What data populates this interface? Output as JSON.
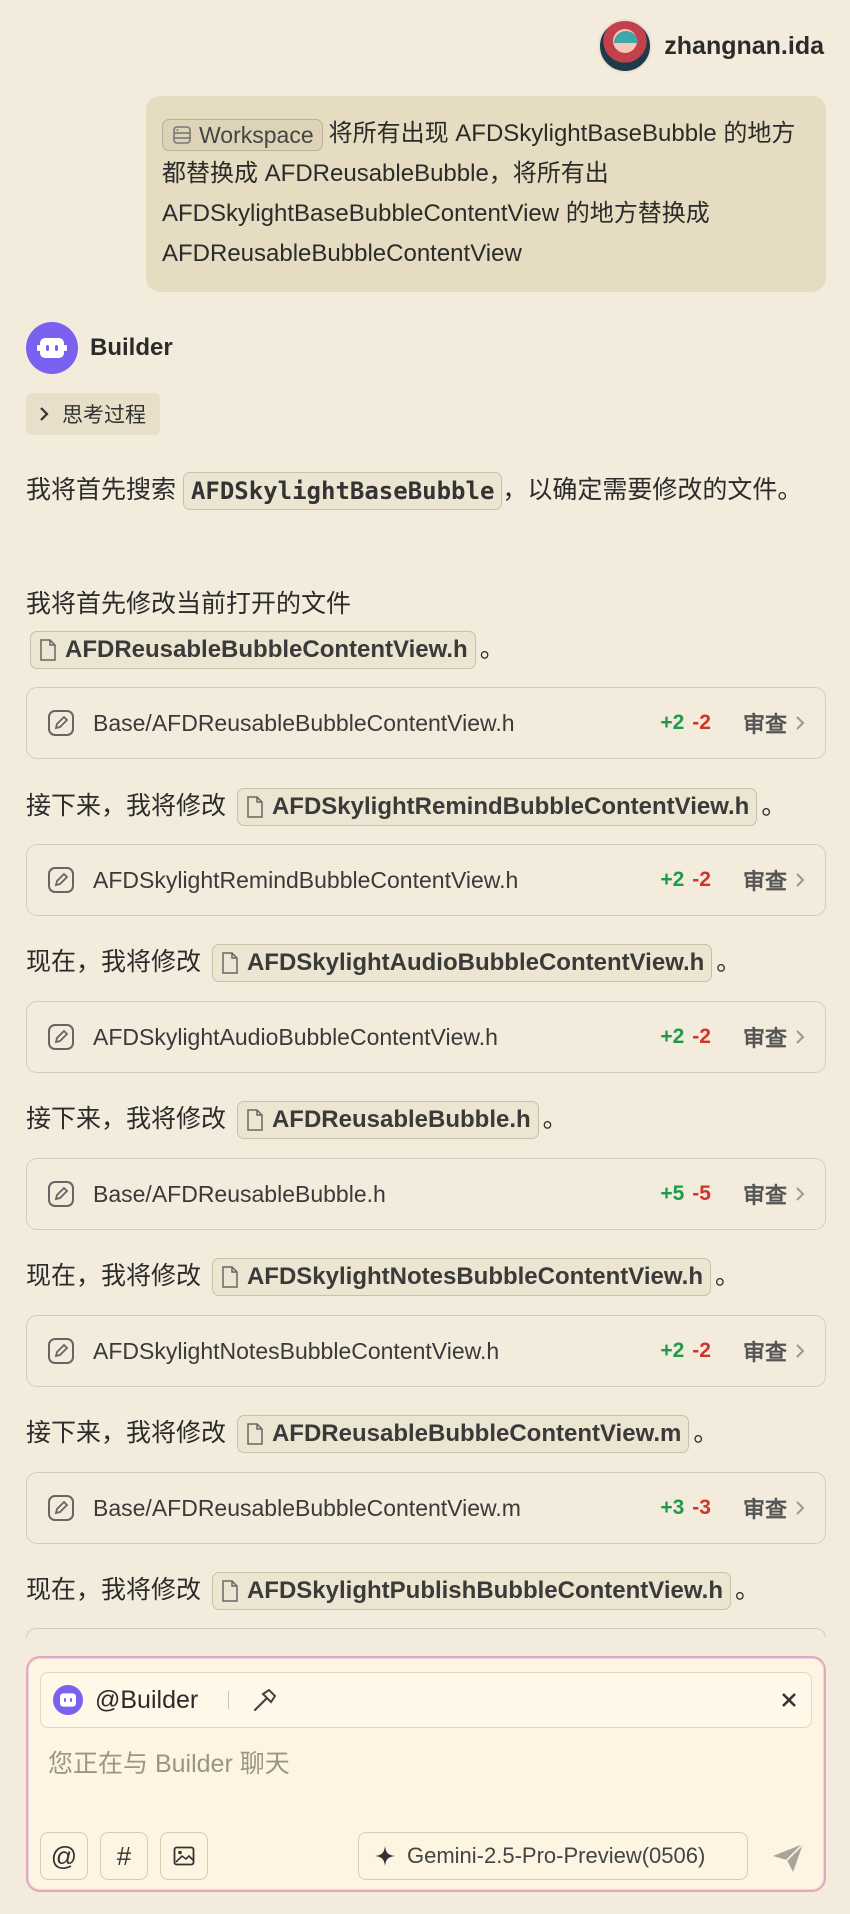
{
  "user": {
    "name": "zhangnan.ida"
  },
  "user_message": {
    "chip_label": "Workspace",
    "text": "将所有出现 AFDSkylightBaseBubble 的地方都替换成 AFDReusableBubble，将所有出 AFDSkylightBaseBubbleContentView 的地方替换成 AFDReusableBubbleContentView"
  },
  "assistant": {
    "name": "Builder",
    "thinking_label": "思考过程",
    "intro": {
      "before": "我将首先搜索 ",
      "code": "AFDSkylightBaseBubble",
      "after": "，以确定需要修改的文件。"
    },
    "steps": [
      {
        "prefix": "我将首先修改当前打开的文件",
        "file": "AFDReusableBubbleContentView.h",
        "suffix": "。"
      },
      {
        "prefix": "接下来，我将修改",
        "file": "AFDSkylightRemindBubbleContentView.h",
        "suffix": "。"
      },
      {
        "prefix": "现在，我将修改",
        "file": "AFDSkylightAudioBubbleContentView.h",
        "suffix": "。"
      },
      {
        "prefix": "接下来，我将修改",
        "file": "AFDReusableBubble.h",
        "suffix": "。"
      },
      {
        "prefix": "现在，我将修改",
        "file": "AFDSkylightNotesBubbleContentView.h",
        "suffix": "。"
      },
      {
        "prefix": "接下来，我将修改",
        "file": "AFDReusableBubbleContentView.m",
        "suffix": "。"
      },
      {
        "prefix": "现在，我将修改",
        "file": "AFDSkylightPublishBubbleContentView.h",
        "suffix": "。"
      }
    ],
    "changes": [
      {
        "path": "Base/AFDReusableBubbleContentView.h",
        "added": "+2",
        "removed": "-2",
        "review": "审查"
      },
      {
        "path": "AFDSkylightRemindBubbleContentView.h",
        "added": "+2",
        "removed": "-2",
        "review": "审查"
      },
      {
        "path": "AFDSkylightAudioBubbleContentView.h",
        "added": "+2",
        "removed": "-2",
        "review": "审查"
      },
      {
        "path": "Base/AFDReusableBubble.h",
        "added": "+5",
        "removed": "-5",
        "review": "审查"
      },
      {
        "path": "AFDSkylightNotesBubbleContentView.h",
        "added": "+2",
        "removed": "-2",
        "review": "审查"
      },
      {
        "path": "Base/AFDReusableBubbleContentView.m",
        "added": "+3",
        "removed": "-3",
        "review": "审查"
      }
    ]
  },
  "composer": {
    "mention": "@Builder",
    "placeholder": "您正在与 Builder 聊天",
    "at_symbol": "@",
    "hash_symbol": "#",
    "model": "Gemini-2.5-Pro-Preview(0506)"
  },
  "colors": {
    "accent": "#7b61f0",
    "added": "#1f9a4a",
    "removed": "#d0342c",
    "background": "#f3ecdc"
  },
  "icons": [
    "workspace-icon",
    "robot-icon",
    "chevron-right-icon",
    "file-icon",
    "edit-icon",
    "hammer-icon",
    "close-icon",
    "image-icon",
    "sparkle-icon",
    "send-icon"
  ]
}
